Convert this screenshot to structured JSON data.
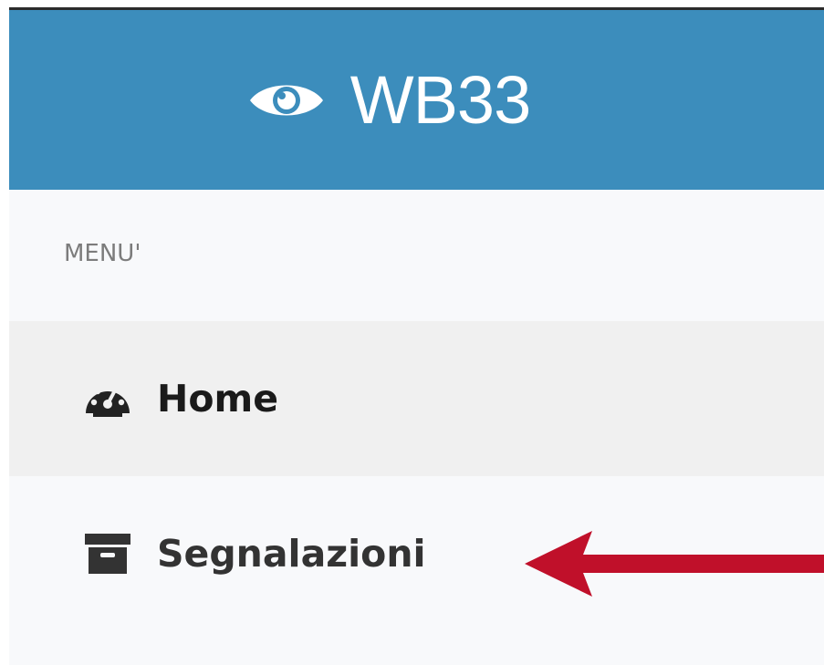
{
  "brand": {
    "title": "WB33",
    "icon": "eye-icon",
    "background_color": "#3c8dbc"
  },
  "menu": {
    "header": "MENU'",
    "items": [
      {
        "label": "Home",
        "icon": "dashboard-icon",
        "active": true
      },
      {
        "label": "Segnalazioni",
        "icon": "archive-icon",
        "active": false
      }
    ]
  },
  "annotation": {
    "type": "arrow",
    "color": "#c0102a",
    "points_to": "Segnalazioni"
  }
}
